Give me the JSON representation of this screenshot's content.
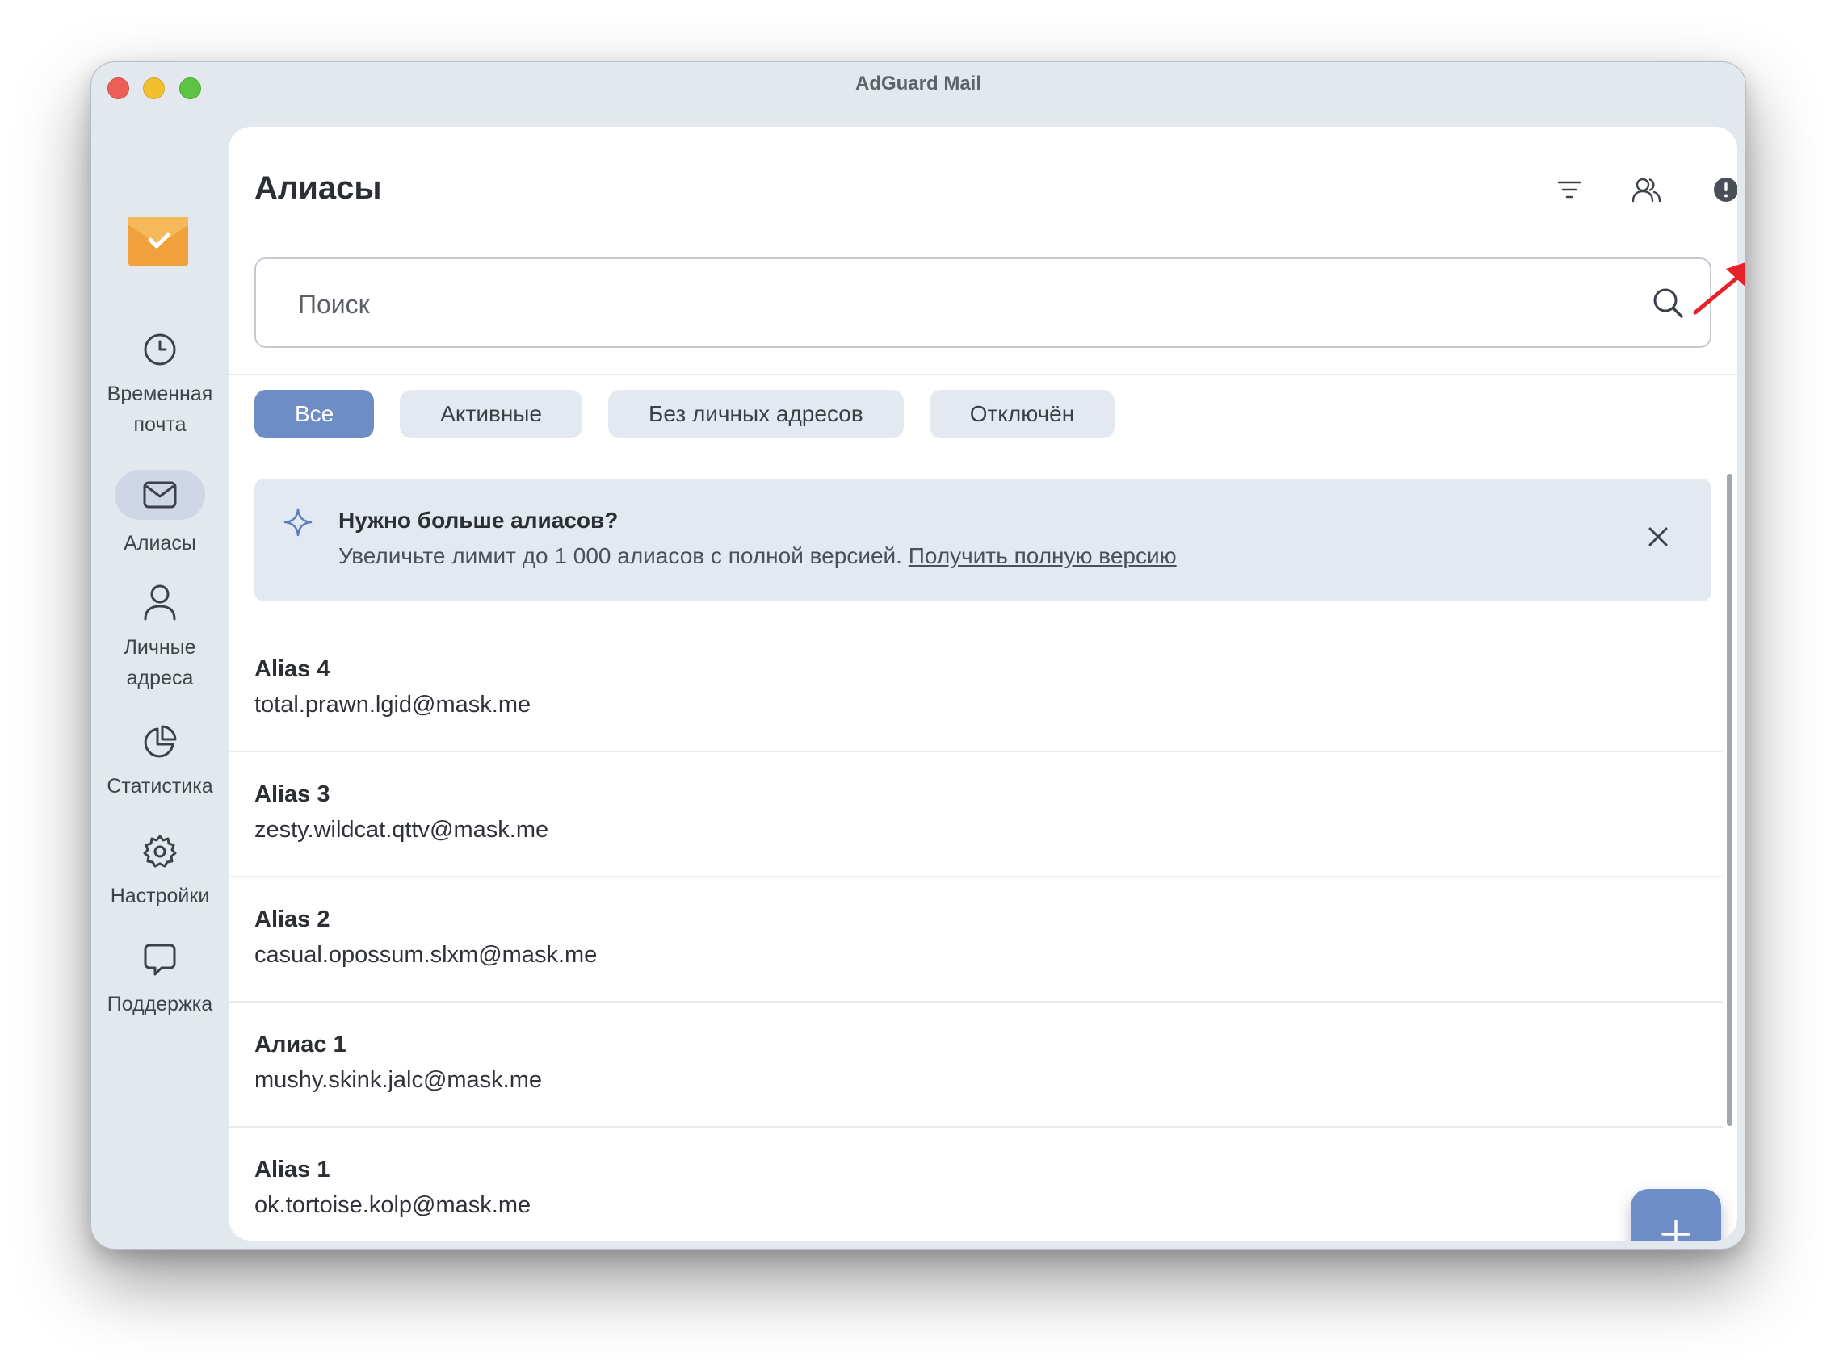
{
  "window": {
    "title": "AdGuard Mail"
  },
  "sidebar": {
    "items": [
      {
        "label": "Временная почта",
        "icon": "clock-icon",
        "active": false
      },
      {
        "label": "Алиасы",
        "icon": "envelope-icon",
        "active": true
      },
      {
        "label": "Личные адреса",
        "icon": "person-icon",
        "active": false
      },
      {
        "label": "Статистика",
        "icon": "pie-chart-icon",
        "active": false
      },
      {
        "label": "Настройки",
        "icon": "gear-icon",
        "active": false
      },
      {
        "label": "Поддержка",
        "icon": "chat-bubble-icon",
        "active": false
      }
    ]
  },
  "header": {
    "title": "Алиасы",
    "icons": [
      "filter-icon",
      "users-icon",
      "alert-circle-icon"
    ]
  },
  "search": {
    "placeholder": "Поиск"
  },
  "filters": [
    {
      "label": "Все",
      "active": true
    },
    {
      "label": "Активные",
      "active": false
    },
    {
      "label": "Без личных адресов",
      "active": false
    },
    {
      "label": "Отключён",
      "active": false
    }
  ],
  "banner": {
    "title": "Нужно больше алиасов?",
    "text": "Увеличьте лимит до 1 000 алиасов с полной версией.",
    "link": "Получить полную версию"
  },
  "aliases": [
    {
      "name": "Alias 4",
      "email": "total.prawn.lgid@mask.me"
    },
    {
      "name": "Alias 3",
      "email": "zesty.wildcat.qttv@mask.me"
    },
    {
      "name": "Alias 2",
      "email": "casual.opossum.slxm@mask.me"
    },
    {
      "name": "Алиас 1",
      "email": "mushy.skink.jalc@mask.me"
    },
    {
      "name": "Alias 1",
      "email": "ok.tortoise.kolp@mask.me"
    }
  ],
  "colors": {
    "accent": "#6e8cc6",
    "logo": "#f0a03c",
    "annotation": "#e8202a"
  }
}
